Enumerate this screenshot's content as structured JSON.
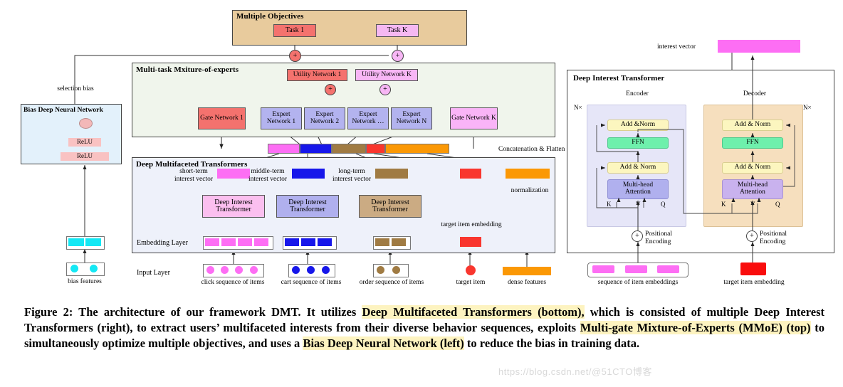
{
  "figure": {
    "caption_prefix": "Figure 2: The architecture of our framework DMT. It utilizes ",
    "caption_hl1": "Deep Multifaceted Transformers (bottom),",
    "caption_mid1": " which is consisted of multiple Deep Interest Transformers (right), to extract users’ multifaceted interests from their diverse behavior sequences, exploits ",
    "caption_hl2": "Multi-gate Mixture-of-Experts (MMoE) (top)",
    "caption_mid2": " to simultaneously optimize multiple objectives, and uses a ",
    "caption_hl3": "Bias Deep Neural Network (left)",
    "caption_suffix": " to reduce the bias in training data.",
    "watermark": "https://blog.csdn.net/@51CTO博客"
  },
  "objectives": {
    "title": "Multiple Objectives",
    "tasks": [
      {
        "label": "Task 1",
        "color": "#f4726e"
      },
      {
        "label": "Task K",
        "color": "#f5b8f2"
      }
    ],
    "panel_color": "#e8cb9d"
  },
  "mmoe": {
    "title": "Multi-task Mxiture-of-experts",
    "panel_color": "#f0f5ec",
    "utility_networks": [
      {
        "label": "Utility Network 1",
        "color": "#f4726e"
      },
      {
        "label": "Utility Network  K",
        "color": "#f7b6f5"
      }
    ],
    "gates": [
      {
        "label": "Gate Network 1",
        "color": "#f4726e"
      },
      {
        "label": "Gate Network K",
        "color": "#f9b4f7"
      }
    ],
    "experts": [
      {
        "label": "Expert Network 1"
      },
      {
        "label": "Expert Network 2"
      },
      {
        "label": "Expert Network …"
      },
      {
        "label": "Expert Network N"
      }
    ],
    "expert_color": "#b3b3ef",
    "plus_symbol": "+"
  },
  "bias_net": {
    "title": "Bias Deep Neural Network",
    "panel_color": "#e3f1fb",
    "selection_bias_label": "selection bias",
    "activations": [
      "ReLU",
      "ReLU"
    ],
    "activation_color": "#f9c2c2",
    "node_color": "#f3b8b8",
    "features_label": "bias features",
    "feature_color": "#14e8f4"
  },
  "dmt": {
    "title": "Deep Multifaceted Transformers",
    "panel_color": "#eef1fa",
    "concat_label": "Concatenation & Flatten",
    "embedding_layer_label": "Embedding Layer",
    "input_layer_label": "Input Layer",
    "normalization_label": "normalization",
    "target_item_embedding_label": "target item embedding",
    "branches": [
      {
        "interest_label": "short-term\ninterest vector",
        "interest_line1": "short-term",
        "interest_line2": "interest vector",
        "transformer_label": "Deep Interest Transformer",
        "input_label": "click sequence of items",
        "color": "#fd6ef4",
        "box_color": "#fbbfef",
        "n_items": 4
      },
      {
        "interest_line1": "middle-term",
        "interest_line2": "interest vector",
        "transformer_label": "Deep Interest Transformer",
        "input_label": "cart sequence of items",
        "color": "#1717ea",
        "box_color": "#b0b0ee",
        "n_items": 3
      },
      {
        "interest_line1": "long-term",
        "interest_line2": "interest vector",
        "transformer_label": "Deep Interest Transformer",
        "input_label": "order sequence of items",
        "color": "#a07b43",
        "box_color": "#cbab83",
        "n_items": 2
      }
    ],
    "target_item_label": "target item",
    "target_item_color": "#f9362e",
    "dense_features_label": "dense features",
    "dense_features_color": "#fb9805",
    "transformer_line1": "Deep Interest",
    "transformer_line2": "Transformer"
  },
  "dit": {
    "title": "Deep Interest Transformer",
    "interest_vector_label": "interest vector",
    "interest_vector_color": "#fd6ef4",
    "encoder": {
      "label": "Encoder",
      "n_label": "N×",
      "panel_color": "#e6e6f8",
      "blocks": [
        {
          "label": "Add &Norm",
          "color": "#fcf6bf"
        },
        {
          "label": "FFN",
          "color": "#6ef0ac"
        },
        {
          "label": "Add & Norm",
          "color": "#fcf6bf"
        },
        {
          "label": "Multi-head Attention",
          "color": "#b0b0ee"
        }
      ],
      "kvq": [
        "K",
        "V",
        "Q"
      ],
      "pos_line1": "Positional",
      "pos_line2": "Encoding",
      "input_label": "sequence of item embeddings",
      "input_color": "#fd6ef4"
    },
    "decoder": {
      "label": "Decoder",
      "n_label": "N×",
      "panel_color": "#f6dfbe",
      "blocks": [
        {
          "label": "Add & Norm",
          "color": "#fcf6bf"
        },
        {
          "label": "FFN",
          "color": "#6ef0ac"
        },
        {
          "label": "Add & Norm",
          "color": "#fcf6bf"
        },
        {
          "label": "Multi-head Attention",
          "color": "#c9b2ee"
        }
      ],
      "kvq": [
        "K",
        "V",
        "Q"
      ],
      "pos_line1": "Positional",
      "pos_line2": "Encoding",
      "input_label": "target item embedding",
      "input_color": "#f90d0d"
    },
    "mha_line1": "Multi-head",
    "mha_line2": "Attention"
  }
}
